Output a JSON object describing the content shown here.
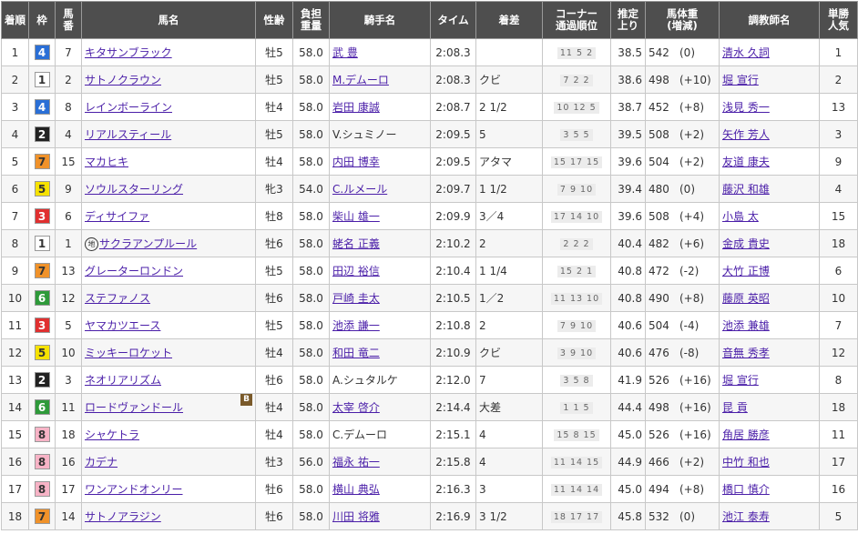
{
  "headers": {
    "rank": "着順",
    "frame": "枠",
    "horse_no": "馬\n番",
    "horse_name": "馬名",
    "sex_age": "性齢",
    "weight_load": "負担\n重量",
    "jockey": "騎手名",
    "time": "タイム",
    "margin": "着差",
    "corners": "コーナー\n通過順位",
    "last3f": "推定\n上り",
    "body_weight": "馬体重\n(増減)",
    "trainer": "調教師名",
    "popularity": "単勝\n人気"
  },
  "frame_colors": {
    "1": {
      "bg": "#ffffff",
      "fg": "#333333"
    },
    "2": {
      "bg": "#222222",
      "fg": "#ffffff"
    },
    "3": {
      "bg": "#e03030",
      "fg": "#ffffff"
    },
    "4": {
      "bg": "#2a6fd6",
      "fg": "#ffffff"
    },
    "5": {
      "bg": "#f6e200",
      "fg": "#333333"
    },
    "6": {
      "bg": "#2e9a3a",
      "fg": "#ffffff"
    },
    "7": {
      "bg": "#f0922a",
      "fg": "#333333"
    },
    "8": {
      "bg": "#f7b3c6",
      "fg": "#333333"
    }
  },
  "rows": [
    {
      "rank": "1",
      "frame": "4",
      "no": "7",
      "name": "キタサンブラック",
      "mark": "",
      "blink": "",
      "sex_age": "牡5",
      "load": "58.0",
      "jockey": "武 豊",
      "jockey_link": true,
      "time": "2:08.3",
      "margin": "",
      "corners": "11 5 2",
      "last3f": "38.5",
      "weight": "542",
      "diff": "(0)",
      "trainer": "清水 久詞",
      "pop": "1"
    },
    {
      "rank": "2",
      "frame": "1",
      "no": "2",
      "name": "サトノクラウン",
      "mark": "",
      "blink": "",
      "sex_age": "牡5",
      "load": "58.0",
      "jockey": "M.デムーロ",
      "jockey_link": true,
      "time": "2:08.3",
      "margin": "クビ",
      "corners": "7 2 2",
      "last3f": "38.6",
      "weight": "498",
      "diff": "(+10)",
      "trainer": "堀 宣行",
      "pop": "2"
    },
    {
      "rank": "3",
      "frame": "4",
      "no": "8",
      "name": "レインボーライン",
      "mark": "",
      "blink": "",
      "sex_age": "牡4",
      "load": "58.0",
      "jockey": "岩田 康誠",
      "jockey_link": true,
      "time": "2:08.7",
      "margin": "2 1/2",
      "corners": "10 12 5",
      "last3f": "38.7",
      "weight": "452",
      "diff": "(+8)",
      "trainer": "浅見 秀一",
      "pop": "13"
    },
    {
      "rank": "4",
      "frame": "2",
      "no": "4",
      "name": "リアルスティール",
      "mark": "",
      "blink": "",
      "sex_age": "牡5",
      "load": "58.0",
      "jockey": "V.シュミノー",
      "jockey_link": false,
      "time": "2:09.5",
      "margin": "5",
      "corners": "3 5 5",
      "last3f": "39.5",
      "weight": "508",
      "diff": "(+2)",
      "trainer": "矢作 芳人",
      "pop": "3"
    },
    {
      "rank": "5",
      "frame": "7",
      "no": "15",
      "name": "マカヒキ",
      "mark": "",
      "blink": "",
      "sex_age": "牡4",
      "load": "58.0",
      "jockey": "内田 博幸",
      "jockey_link": true,
      "time": "2:09.5",
      "margin": "アタマ",
      "corners": "15 17 15",
      "last3f": "39.6",
      "weight": "504",
      "diff": "(+2)",
      "trainer": "友道 康夫",
      "pop": "9"
    },
    {
      "rank": "6",
      "frame": "5",
      "no": "9",
      "name": "ソウルスターリング",
      "mark": "",
      "blink": "",
      "sex_age": "牝3",
      "load": "54.0",
      "jockey": "C.ルメール",
      "jockey_link": true,
      "time": "2:09.7",
      "margin": "1 1/2",
      "corners": "7 9 10",
      "last3f": "39.4",
      "weight": "480",
      "diff": "(0)",
      "trainer": "藤沢 和雄",
      "pop": "4"
    },
    {
      "rank": "7",
      "frame": "3",
      "no": "6",
      "name": "ディサイファ",
      "mark": "",
      "blink": "",
      "sex_age": "牡8",
      "load": "58.0",
      "jockey": "柴山 雄一",
      "jockey_link": true,
      "time": "2:09.9",
      "margin": "3／4",
      "corners": "17 14 10",
      "last3f": "39.6",
      "weight": "508",
      "diff": "(+4)",
      "trainer": "小島 太",
      "pop": "15"
    },
    {
      "rank": "8",
      "frame": "1",
      "no": "1",
      "name": "サクラアンプルール",
      "mark": "地",
      "blink": "",
      "sex_age": "牡6",
      "load": "58.0",
      "jockey": "蛯名 正義",
      "jockey_link": true,
      "time": "2:10.2",
      "margin": "2",
      "corners": "2 2 2",
      "last3f": "40.4",
      "weight": "482",
      "diff": "(+6)",
      "trainer": "金成 貴史",
      "pop": "18"
    },
    {
      "rank": "9",
      "frame": "7",
      "no": "13",
      "name": "グレーターロンドン",
      "mark": "",
      "blink": "",
      "sex_age": "牡5",
      "load": "58.0",
      "jockey": "田辺 裕信",
      "jockey_link": true,
      "time": "2:10.4",
      "margin": "1 1/4",
      "corners": "15 2 1",
      "last3f": "40.8",
      "weight": "472",
      "diff": "(-2)",
      "trainer": "大竹 正博",
      "pop": "6"
    },
    {
      "rank": "10",
      "frame": "6",
      "no": "12",
      "name": "ステファノス",
      "mark": "",
      "blink": "",
      "sex_age": "牡6",
      "load": "58.0",
      "jockey": "戸崎 圭太",
      "jockey_link": true,
      "time": "2:10.5",
      "margin": "1／2",
      "corners": "11 13 10",
      "last3f": "40.8",
      "weight": "490",
      "diff": "(+8)",
      "trainer": "藤原 英昭",
      "pop": "10"
    },
    {
      "rank": "11",
      "frame": "3",
      "no": "5",
      "name": "ヤマカツエース",
      "mark": "",
      "blink": "",
      "sex_age": "牡5",
      "load": "58.0",
      "jockey": "池添 謙一",
      "jockey_link": true,
      "time": "2:10.8",
      "margin": "2",
      "corners": "7 9 10",
      "last3f": "40.6",
      "weight": "504",
      "diff": "(-4)",
      "trainer": "池添 兼雄",
      "pop": "7"
    },
    {
      "rank": "12",
      "frame": "5",
      "no": "10",
      "name": "ミッキーロケット",
      "mark": "",
      "blink": "",
      "sex_age": "牡4",
      "load": "58.0",
      "jockey": "和田 竜二",
      "jockey_link": true,
      "time": "2:10.9",
      "margin": "クビ",
      "corners": "3 9 10",
      "last3f": "40.6",
      "weight": "476",
      "diff": "(-8)",
      "trainer": "音無 秀孝",
      "pop": "12"
    },
    {
      "rank": "13",
      "frame": "2",
      "no": "3",
      "name": "ネオリアリズム",
      "mark": "",
      "blink": "",
      "sex_age": "牡6",
      "load": "58.0",
      "jockey": "A.シュタルケ",
      "jockey_link": false,
      "time": "2:12.0",
      "margin": "7",
      "corners": "3 5 8",
      "last3f": "41.9",
      "weight": "526",
      "diff": "(+16)",
      "trainer": "堀 宣行",
      "pop": "8"
    },
    {
      "rank": "14",
      "frame": "6",
      "no": "11",
      "name": "ロードヴァンドール",
      "mark": "",
      "blink": "B",
      "sex_age": "牡4",
      "load": "58.0",
      "jockey": "太宰 啓介",
      "jockey_link": true,
      "time": "2:14.4",
      "margin": "大差",
      "corners": "1 1 5",
      "last3f": "44.4",
      "weight": "498",
      "diff": "(+16)",
      "trainer": "昆 貢",
      "pop": "18"
    },
    {
      "rank": "15",
      "frame": "8",
      "no": "18",
      "name": "シャケトラ",
      "mark": "",
      "blink": "",
      "sex_age": "牡4",
      "load": "58.0",
      "jockey": "C.デムーロ",
      "jockey_link": false,
      "time": "2:15.1",
      "margin": "4",
      "corners": "15 8 15",
      "last3f": "45.0",
      "weight": "526",
      "diff": "(+16)",
      "trainer": "角居 勝彦",
      "pop": "11"
    },
    {
      "rank": "16",
      "frame": "8",
      "no": "16",
      "name": "カデナ",
      "mark": "",
      "blink": "",
      "sex_age": "牡3",
      "load": "56.0",
      "jockey": "福永 祐一",
      "jockey_link": true,
      "time": "2:15.8",
      "margin": "4",
      "corners": "11 14 15",
      "last3f": "44.9",
      "weight": "466",
      "diff": "(+2)",
      "trainer": "中竹 和也",
      "pop": "17"
    },
    {
      "rank": "17",
      "frame": "8",
      "no": "17",
      "name": "ワンアンドオンリー",
      "mark": "",
      "blink": "",
      "sex_age": "牡6",
      "load": "58.0",
      "jockey": "横山 典弘",
      "jockey_link": true,
      "time": "2:16.3",
      "margin": "3",
      "corners": "11 14 14",
      "last3f": "45.0",
      "weight": "494",
      "diff": "(+8)",
      "trainer": "橋口 慎介",
      "pop": "16"
    },
    {
      "rank": "18",
      "frame": "7",
      "no": "14",
      "name": "サトノアラジン",
      "mark": "",
      "blink": "",
      "sex_age": "牡6",
      "load": "58.0",
      "jockey": "川田 将雅",
      "jockey_link": true,
      "time": "2:16.9",
      "margin": "3 1/2",
      "corners": "18 17 17",
      "last3f": "45.8",
      "weight": "532",
      "diff": "(0)",
      "trainer": "池江 泰寿",
      "pop": "5"
    }
  ]
}
